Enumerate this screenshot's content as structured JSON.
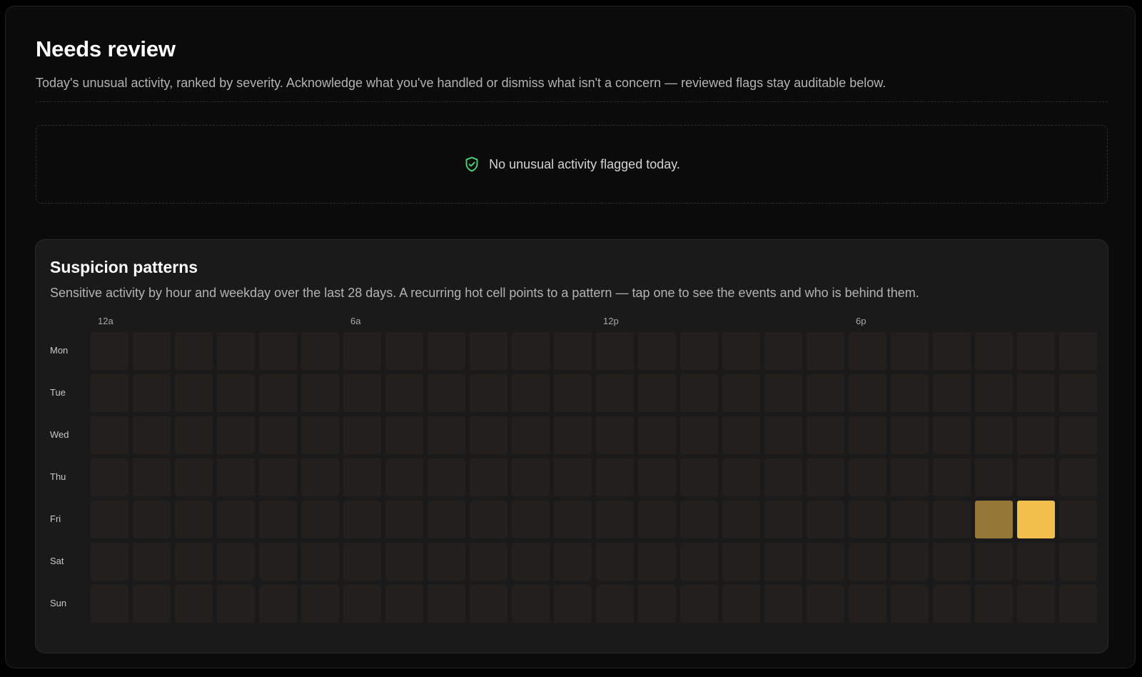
{
  "needs_review": {
    "title": "Needs review",
    "subtitle": "Today's unusual activity, ranked by severity. Acknowledge what you've handled or dismiss what isn't a concern — reviewed flags stay auditable below.",
    "empty_state": {
      "icon": "shield-check-icon",
      "text": "No unusual activity flagged today."
    }
  },
  "suspicion_patterns": {
    "title": "Suspicion patterns",
    "subtitle": "Sensitive activity by hour and weekday over the last 28 days. A recurring hot cell points to a pattern — tap one to see the events and who is behind them.",
    "hour_labels": [
      {
        "hour": 0,
        "label": "12a"
      },
      {
        "hour": 6,
        "label": "6a"
      },
      {
        "hour": 12,
        "label": "12p"
      },
      {
        "hour": 18,
        "label": "6p"
      }
    ],
    "days": [
      "Mon",
      "Tue",
      "Wed",
      "Thu",
      "Fri",
      "Sat",
      "Sun"
    ],
    "hours": 24,
    "hot_cells": [
      {
        "day": "Fri",
        "hour": 21,
        "intensity": 0.55
      },
      {
        "day": "Fri",
        "hour": 22,
        "intensity": 1.0
      }
    ]
  },
  "colors": {
    "background": "#0b0b0b",
    "card": "#1a1a1a",
    "cell_empty": "#221f1c",
    "cell_hot": "#f2be4b",
    "cell_warm": "#9a7b34",
    "shield_green": "#4ade80"
  }
}
